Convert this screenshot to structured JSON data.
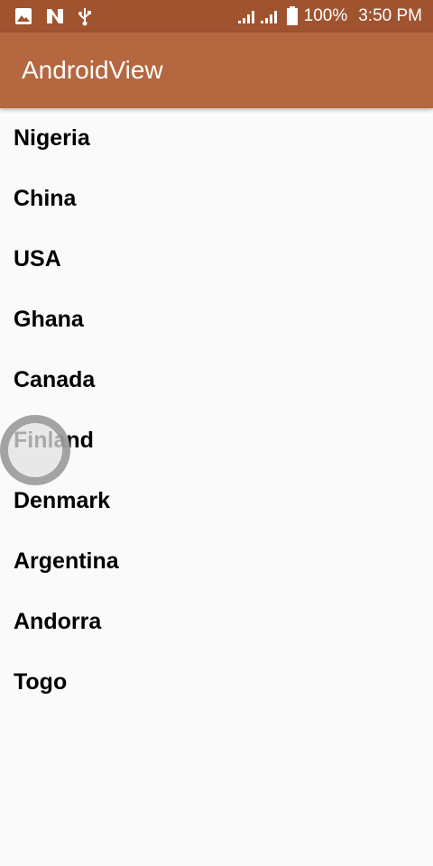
{
  "status_bar": {
    "icons_left": [
      "image-icon",
      "n-notification-icon",
      "usb-icon"
    ],
    "icons_right": [
      "signal-icon",
      "battery-icon"
    ],
    "battery": "100%",
    "time": "3:50 PM"
  },
  "app_bar": {
    "title": "AndroidView",
    "color": "#b5673f"
  },
  "list": {
    "items": [
      "Nigeria",
      "China",
      "USA",
      "Ghana",
      "Canada",
      "Finland",
      "Denmark",
      "Argentina",
      "Andorra",
      "Togo"
    ]
  },
  "colors": {
    "status_bar": "#a0532f",
    "app_bar": "#b5673f",
    "background": "#fafafa"
  }
}
